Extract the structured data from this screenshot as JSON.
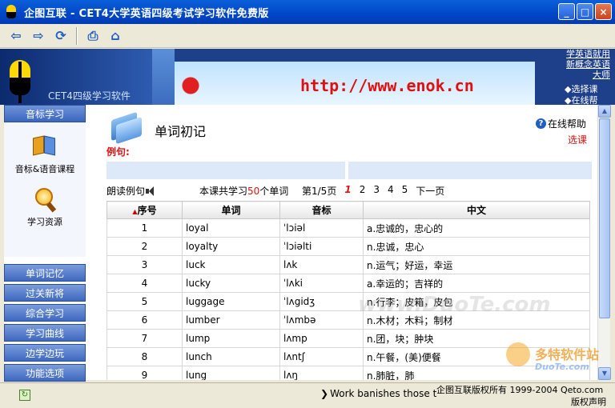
{
  "window": {
    "title": "企图互联 - CET4大学英语四级考试学习软件免费版",
    "buttons": [
      "_",
      "□",
      "×"
    ]
  },
  "toolbar": {
    "icons": [
      "back-arrow-icon",
      "forward-arrow-icon",
      "refresh-icon",
      "print-icon",
      "home-icon"
    ]
  },
  "banner": {
    "product_name": "CET4四级学习软件",
    "url": "http://www.enok.cn",
    "promo": "学英语就用新概念英语大师",
    "link1": "◆选择课",
    "link2": "◆在线帮"
  },
  "sidebar": {
    "header": "音标学习",
    "icon_items": [
      {
        "label": "音标&语音课程",
        "icon": "book-icon"
      },
      {
        "label": "学习资源",
        "icon": "magnifier-icon"
      }
    ],
    "buttons": [
      "单词记忆",
      "过关新将",
      "综合学习",
      "学习曲线",
      "边学边玩",
      "功能选项"
    ]
  },
  "content": {
    "title": "单词初记",
    "help_label": "在线帮助",
    "select_course": "选课",
    "example_label": "例句:",
    "read_example": "朗读例句",
    "course_info_prefix": "本课共学习",
    "course_word_count": "50",
    "course_info_suffix": "个单词",
    "page_info": "第1/5页",
    "pages": [
      "1",
      "2",
      "3",
      "4",
      "5"
    ],
    "current_page": "1",
    "next_page": "下一页"
  },
  "table": {
    "columns": [
      "序号",
      "单词",
      "音标",
      "中文"
    ],
    "rows": [
      {
        "no": "1",
        "word": "loyal",
        "phonetic": "ˈlɔiəl",
        "meaning": "a.忠诚的，忠心的"
      },
      {
        "no": "2",
        "word": "loyalty",
        "phonetic": "ˈlɔiəlti",
        "meaning": "n.忠诚，忠心"
      },
      {
        "no": "3",
        "word": "luck",
        "phonetic": "lʌk",
        "meaning": "n.运气；好运，幸运"
      },
      {
        "no": "4",
        "word": "lucky",
        "phonetic": "ˈlʌki",
        "meaning": "a.幸运的；吉祥的"
      },
      {
        "no": "5",
        "word": "luggage",
        "phonetic": "ˈlʌgidʒ",
        "meaning": "n.行李；皮箱，皮包"
      },
      {
        "no": "6",
        "word": "lumber",
        "phonetic": "ˈlʌmbə",
        "meaning": "n.木材；木料；制材"
      },
      {
        "no": "7",
        "word": "lump",
        "phonetic": "lʌmp",
        "meaning": "n.团，块；肿块"
      },
      {
        "no": "8",
        "word": "lunch",
        "phonetic": "lʌntʃ",
        "meaning": "n.午餐，(美)便餐"
      },
      {
        "no": "9",
        "word": "lung",
        "phonetic": "lʌŋ",
        "meaning": "n.肺脏，肺"
      }
    ]
  },
  "watermarks": {
    "center": "www.DuoTe.com",
    "corner_cn": "多特软件站",
    "corner_en": "DuoTe.com"
  },
  "statusbar": {
    "ticker": "Work banishes those t",
    "copyright": "企图互联版权所有  1999-2004 Qeto.com",
    "disclaimer": "版权声明"
  },
  "colors": {
    "title_bar": "#0046C8",
    "accent_red": "#E01010",
    "sidebar_button": "#3E68C0"
  }
}
